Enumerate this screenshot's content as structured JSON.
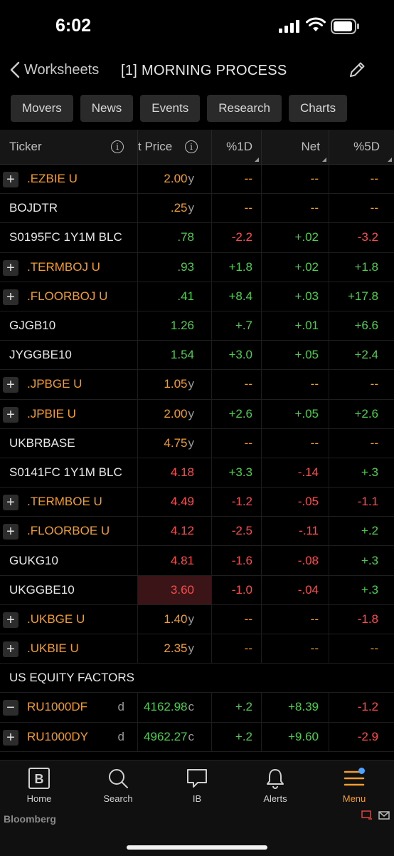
{
  "status_bar": {
    "time": "6:02"
  },
  "nav": {
    "back_label": "Worksheets",
    "title": "[1] MORNING PROCESS"
  },
  "tabs": [
    "Movers",
    "News",
    "Events",
    "Research",
    "Charts"
  ],
  "table": {
    "headers": {
      "ticker": "Ticker",
      "price": "t Price",
      "pct1d": "%1D",
      "net": "Net",
      "pct5d": "%5D"
    },
    "rows": [
      {
        "ticker": ".EZBIE U",
        "expandable": true,
        "tcolor": "orange",
        "price": "2.00",
        "psfx": "y",
        "pcolor": "orange",
        "d1": "--",
        "d1c": "orange",
        "net": "--",
        "netc": "orange",
        "d5": "--",
        "d5c": "orange"
      },
      {
        "ticker": "BOJDTR",
        "expandable": false,
        "tcolor": "white",
        "price": ".25",
        "psfx": "y",
        "pcolor": "orange",
        "d1": "--",
        "d1c": "orange",
        "net": "--",
        "netc": "orange",
        "d5": "--",
        "d5c": "orange"
      },
      {
        "ticker": "S0195FC 1Y1M BLC",
        "expandable": false,
        "tcolor": "white",
        "price": ".78",
        "psfx": "",
        "pcolor": "green",
        "d1": "-2.2",
        "d1c": "red",
        "net": "+.02",
        "netc": "green",
        "d5": "-3.2",
        "d5c": "red"
      },
      {
        "ticker": ".TERMBOJ U",
        "expandable": true,
        "tcolor": "orange",
        "price": ".93",
        "psfx": "",
        "pcolor": "green",
        "d1": "+1.8",
        "d1c": "green",
        "net": "+.02",
        "netc": "green",
        "d5": "+1.8",
        "d5c": "green"
      },
      {
        "ticker": ".FLOORBOJ U",
        "expandable": true,
        "tcolor": "orange",
        "price": ".41",
        "psfx": "",
        "pcolor": "green",
        "d1": "+8.4",
        "d1c": "green",
        "net": "+.03",
        "netc": "green",
        "d5": "+17.8",
        "d5c": "green"
      },
      {
        "ticker": "GJGB10",
        "expandable": false,
        "tcolor": "white",
        "price": "1.26",
        "psfx": "",
        "pcolor": "green",
        "d1": "+.7",
        "d1c": "green",
        "net": "+.01",
        "netc": "green",
        "d5": "+6.6",
        "d5c": "green"
      },
      {
        "ticker": "JYGGBE10",
        "expandable": false,
        "tcolor": "white",
        "price": "1.54",
        "psfx": "",
        "pcolor": "green",
        "d1": "+3.0",
        "d1c": "green",
        "net": "+.05",
        "netc": "green",
        "d5": "+2.4",
        "d5c": "green"
      },
      {
        "ticker": ".JPBGE U",
        "expandable": true,
        "tcolor": "orange",
        "price": "1.05",
        "psfx": "y",
        "pcolor": "orange",
        "d1": "--",
        "d1c": "orange",
        "net": "--",
        "netc": "orange",
        "d5": "--",
        "d5c": "orange"
      },
      {
        "ticker": ".JPBIE U",
        "expandable": true,
        "tcolor": "orange",
        "price": "2.00",
        "psfx": "y",
        "pcolor": "orange",
        "d1": "+2.6",
        "d1c": "green",
        "net": "+.05",
        "netc": "green",
        "d5": "+2.6",
        "d5c": "green"
      },
      {
        "ticker": "UKBRBASE",
        "expandable": false,
        "tcolor": "white",
        "price": "4.75",
        "psfx": "y",
        "pcolor": "orange",
        "d1": "--",
        "d1c": "orange",
        "net": "--",
        "netc": "orange",
        "d5": "--",
        "d5c": "orange"
      },
      {
        "ticker": "S0141FC 1Y1M BLC",
        "expandable": false,
        "tcolor": "white",
        "price": "4.18",
        "psfx": "",
        "pcolor": "red",
        "d1": "+3.3",
        "d1c": "green",
        "net": "-.14",
        "netc": "red",
        "d5": "+.3",
        "d5c": "green"
      },
      {
        "ticker": ".TERMBOE U",
        "expandable": true,
        "tcolor": "orange",
        "price": "4.49",
        "psfx": "",
        "pcolor": "red",
        "d1": "-1.2",
        "d1c": "red",
        "net": "-.05",
        "netc": "red",
        "d5": "-1.1",
        "d5c": "red"
      },
      {
        "ticker": ".FLOORBOE U",
        "expandable": true,
        "tcolor": "orange",
        "price": "4.12",
        "psfx": "",
        "pcolor": "red",
        "d1": "-2.5",
        "d1c": "red",
        "net": "-.11",
        "netc": "red",
        "d5": "+.2",
        "d5c": "green"
      },
      {
        "ticker": "GUKG10",
        "expandable": false,
        "tcolor": "white",
        "price": "4.81",
        "psfx": "",
        "pcolor": "red",
        "d1": "-1.6",
        "d1c": "red",
        "net": "-.08",
        "netc": "red",
        "d5": "+.3",
        "d5c": "green"
      },
      {
        "ticker": "UKGGBE10",
        "expandable": false,
        "tcolor": "white",
        "price": "3.60",
        "psfx": "",
        "pcolor": "red",
        "highlight": true,
        "d1": "-1.0",
        "d1c": "red",
        "net": "-.04",
        "netc": "red",
        "d5": "+.3",
        "d5c": "green"
      },
      {
        "ticker": ".UKBGE U",
        "expandable": true,
        "tcolor": "orange",
        "price": "1.40",
        "psfx": "y",
        "pcolor": "orange",
        "d1": "--",
        "d1c": "orange",
        "net": "--",
        "netc": "orange",
        "d5": "-1.8",
        "d5c": "red"
      },
      {
        "ticker": ".UKBIE U",
        "expandable": true,
        "tcolor": "orange",
        "price": "2.35",
        "psfx": "y",
        "pcolor": "orange",
        "d1": "--",
        "d1c": "orange",
        "net": "--",
        "netc": "orange",
        "d5": "--",
        "d5c": "orange"
      }
    ],
    "section_title": "US EQUITY FACTORS",
    "section_rows": [
      {
        "ticker": "RU1000DF",
        "collapse": true,
        "tcolor": "orange",
        "suffix": "d",
        "price": "4162.98",
        "psfx": "c",
        "pcolor": "green",
        "d1": "+.2",
        "d1c": "green",
        "net": "+8.39",
        "netc": "green",
        "d5": "-1.2",
        "d5c": "red"
      },
      {
        "ticker": "RU1000DY",
        "collapse": false,
        "tcolor": "orange",
        "suffix": "d",
        "price": "4962.27",
        "psfx": "c",
        "pcolor": "green",
        "d1": "+.2",
        "d1c": "green",
        "net": "+9.60",
        "netc": "green",
        "d5": "-2.9",
        "d5c": "red"
      }
    ]
  },
  "bottom_nav": [
    {
      "label": "Home",
      "icon": "bloomberg-b-icon",
      "glyph": "B"
    },
    {
      "label": "Search",
      "icon": "search-icon"
    },
    {
      "label": "IB",
      "icon": "chat-bubble-icon"
    },
    {
      "label": "Alerts",
      "icon": "bell-icon"
    },
    {
      "label": "Menu",
      "icon": "hamburger-menu-icon",
      "active": true
    }
  ],
  "brand": "Bloomberg",
  "colors": {
    "orange": "#f39c2f",
    "green": "#4ccf4c",
    "red": "#ff4a4a",
    "background": "#000000",
    "highlight": "#3a1416",
    "badge": "#4da3ff"
  }
}
